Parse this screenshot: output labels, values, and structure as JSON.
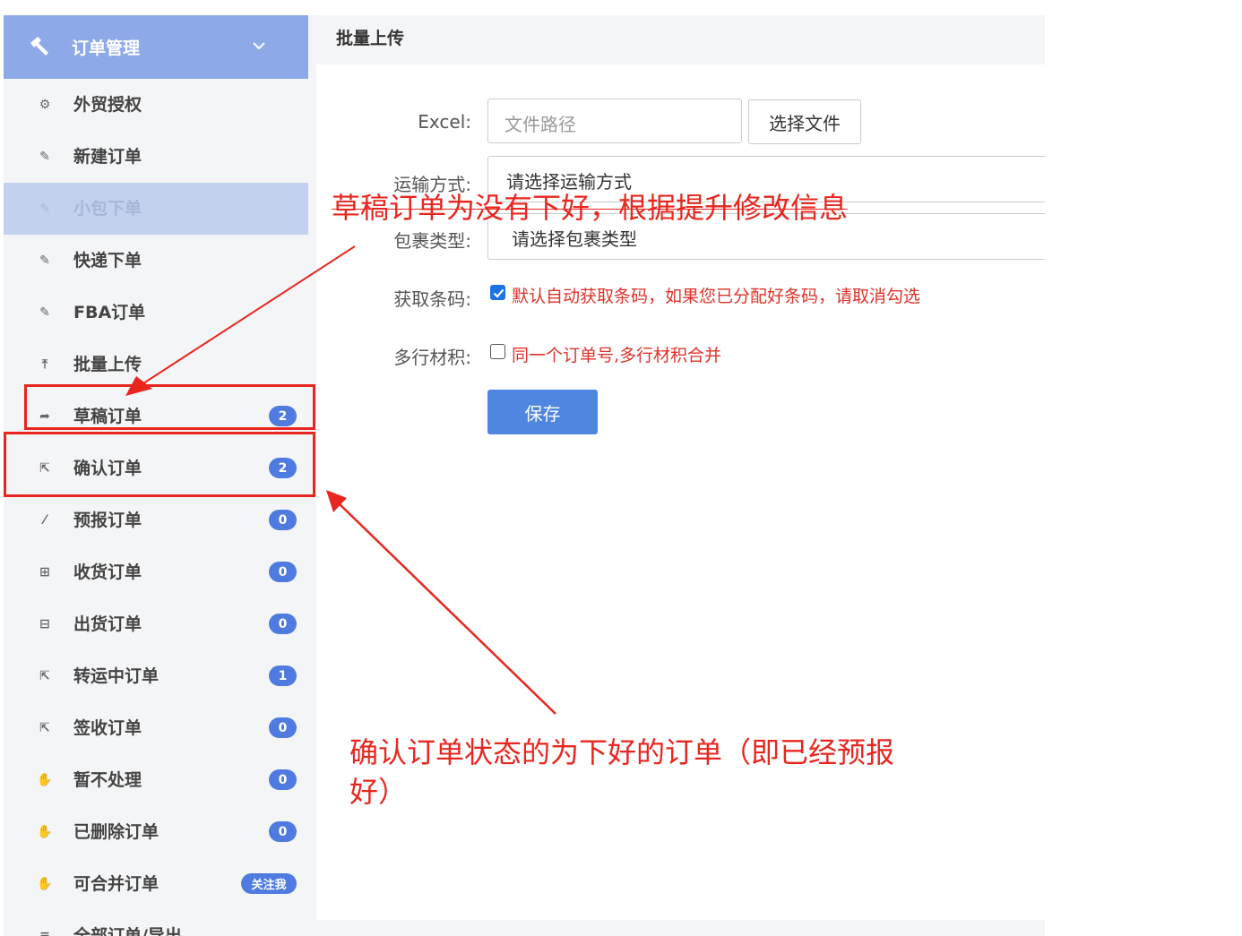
{
  "sidebar": {
    "header": {
      "title": "订单管理",
      "icon": "hammer-icon",
      "chevron": "chevron-down-icon"
    },
    "items": [
      {
        "label": "外贸授权",
        "icon": "gear-icon",
        "badge": null
      },
      {
        "label": "新建订单",
        "icon": "edit-icon",
        "badge": null
      },
      {
        "label": "小包下单",
        "icon": "edit-icon",
        "badge": null,
        "active": true
      },
      {
        "label": "快递下单",
        "icon": "edit-icon",
        "badge": null
      },
      {
        "label": "FBA订单",
        "icon": "edit-icon",
        "badge": null
      },
      {
        "label": "批量上传",
        "icon": "upload-icon",
        "badge": null
      },
      {
        "label": "草稿订单",
        "icon": "share-icon",
        "badge": "2"
      },
      {
        "label": "确认订单",
        "icon": "share-square-icon",
        "badge": "2"
      },
      {
        "label": "预报订单",
        "icon": "wand-icon",
        "badge": "0"
      },
      {
        "label": "收货订单",
        "icon": "plus-square-icon",
        "badge": "0"
      },
      {
        "label": "出货订单",
        "icon": "minus-square-icon",
        "badge": "0"
      },
      {
        "label": "转运中订单",
        "icon": "share-square-icon",
        "badge": "1"
      },
      {
        "label": "签收订单",
        "icon": "share-square-icon",
        "badge": "0"
      },
      {
        "label": "暂不处理",
        "icon": "hand-icon",
        "badge": "0"
      },
      {
        "label": "已删除订单",
        "icon": "hand-icon",
        "badge": "0"
      },
      {
        "label": "可合并订单",
        "icon": "hand-icon",
        "badge": "关注我"
      },
      {
        "label": "全部订单/导出",
        "icon": "list-icon",
        "badge": null
      }
    ]
  },
  "main": {
    "title": "批量上传",
    "form": {
      "excel_label": "Excel:",
      "file_placeholder": "文件路径",
      "choose_file": "选择文件",
      "transport_label": "运输方式:",
      "transport_value": "请选择运输方式",
      "package_label": "包裹类型:",
      "package_value": "请选择包裹类型",
      "barcode_label": "获取条码:",
      "barcode_text": "默认自动获取条码，如果您已分配好条码，请取消勾选",
      "barcode_checked": true,
      "multi_label": "多行材积:",
      "multi_text": "同一个订单号,多行材积合并",
      "multi_checked": false,
      "save": "保存"
    }
  },
  "annotations": {
    "draft_note": "草稿订单为没有下好，根据提升修改信息",
    "confirm_note_line1": "确认订单状态的为下好的订单（即已经预报",
    "confirm_note_line2": "好）",
    "color": "#e8261f"
  }
}
